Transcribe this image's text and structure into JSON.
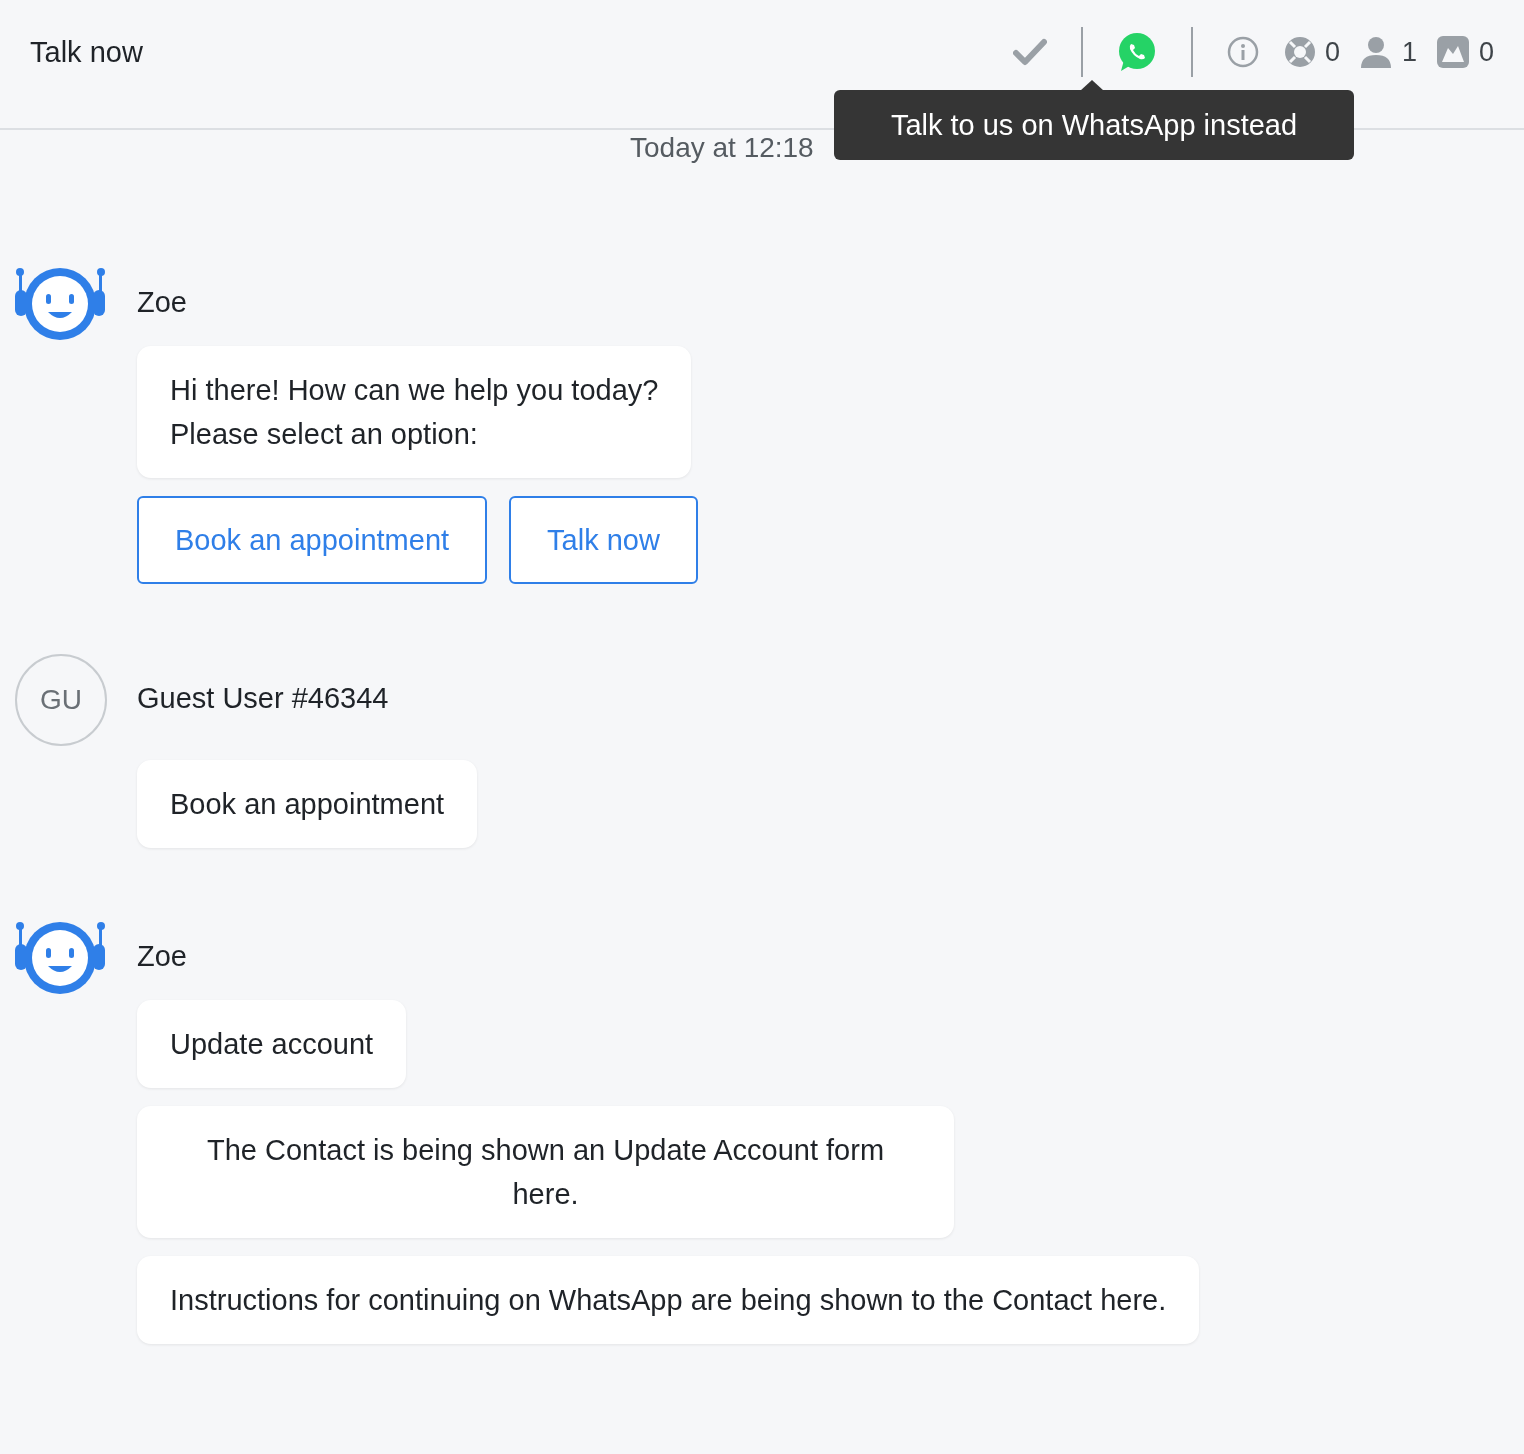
{
  "header": {
    "title": "Talk now",
    "counters": [
      {
        "kind": "support",
        "count": "0"
      },
      {
        "kind": "people",
        "count": "1"
      },
      {
        "kind": "media",
        "count": "0"
      }
    ]
  },
  "tooltip": {
    "text": "Talk to us on WhatsApp instead"
  },
  "timestamp": "Today at 12:18",
  "messages": [
    {
      "kind": "bot",
      "name": "Zoe",
      "bubbles": [
        {
          "text": "Hi there! How can we help you today?\nPlease select an option:",
          "centered": false
        }
      ],
      "options": [
        "Book an appointment",
        "Talk now"
      ]
    },
    {
      "kind": "user",
      "name": "Guest User #46344",
      "initials": "GU",
      "bubbles": [
        {
          "text": "Book an appointment",
          "centered": false
        }
      ]
    },
    {
      "kind": "bot",
      "name": "Zoe",
      "bubbles": [
        {
          "text": "Update account",
          "centered": false
        },
        {
          "text": "The Contact is being shown an Update Account form\nhere.",
          "centered": true
        },
        {
          "text": "Instructions for continuing on WhatsApp are being shown to the Contact here.",
          "centered": false
        }
      ]
    }
  ]
}
